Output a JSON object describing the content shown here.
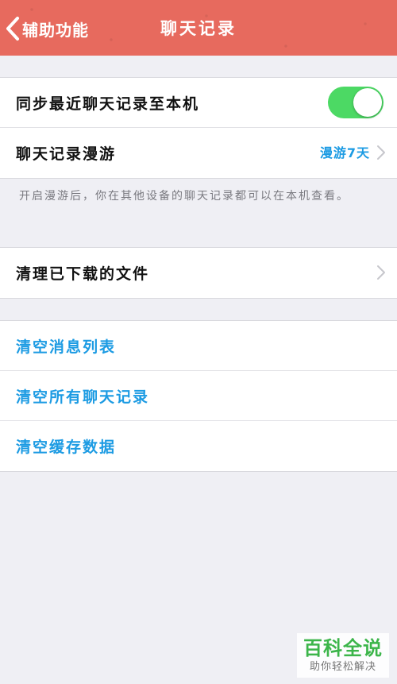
{
  "navbar": {
    "back_label": "辅助功能",
    "title": "聊天记录"
  },
  "group1": {
    "sync_label": "同步最近聊天记录至本机",
    "sync_enabled": true,
    "roaming_label": "聊天记录漫游",
    "roaming_value": "漫游7天"
  },
  "footnote": "开启漫游后，你在其他设备的聊天记录都可以在本机查看。",
  "group2": {
    "clean_files_label": "清理已下载的文件"
  },
  "group3": {
    "clear_messages_label": "清空消息列表",
    "clear_chats_label": "清空所有聊天记录",
    "clear_cache_label": "清空缓存数据"
  },
  "watermark": {
    "brand": "百科全说",
    "slogan": "助你轻松解决"
  },
  "colors": {
    "navbar": "#e76a5e",
    "accent_blue": "#1c9be3",
    "toggle_on": "#4cd964",
    "background": "#efeff4"
  },
  "icons": [
    "chevron-left-icon",
    "chevron-right-icon"
  ]
}
